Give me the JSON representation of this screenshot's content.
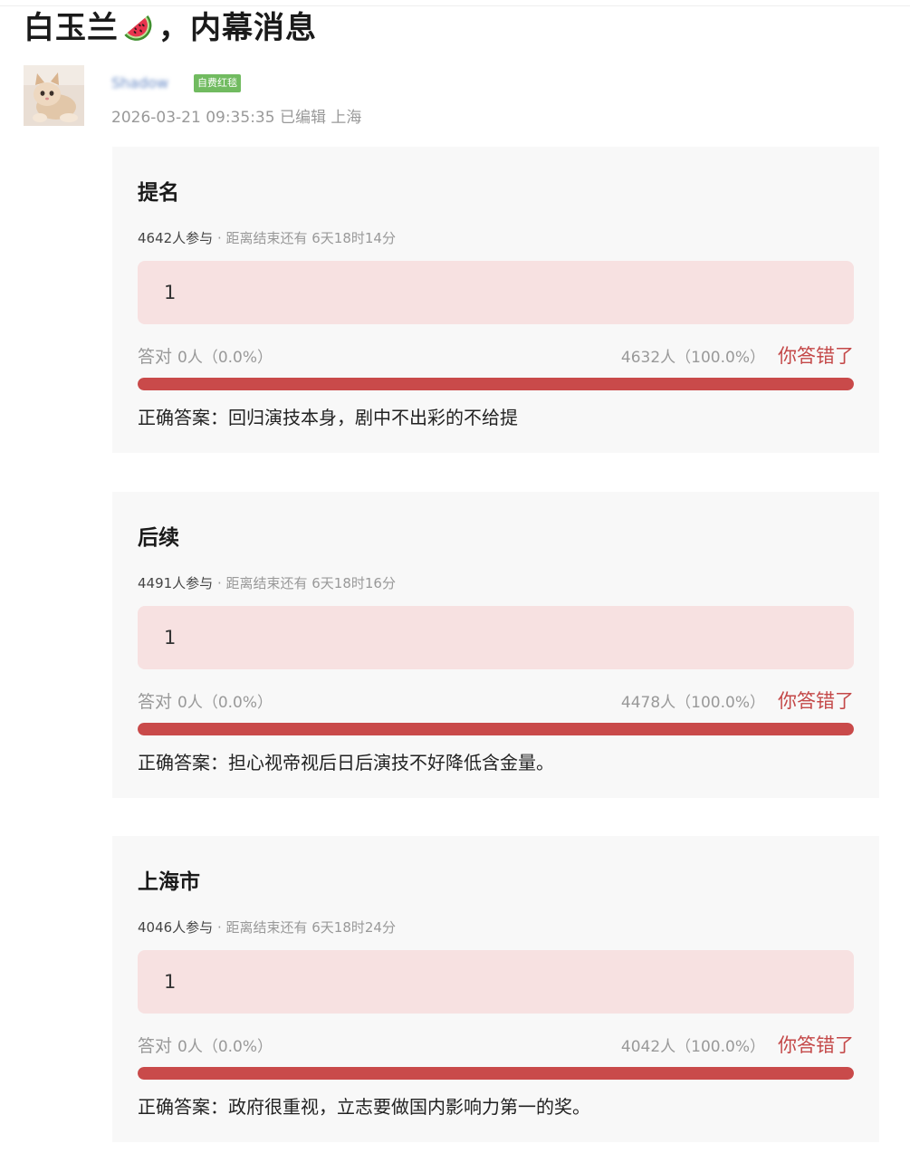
{
  "post": {
    "title_before": "白玉兰",
    "title_emoji": "watermelon-icon",
    "title_after": "，内幕消息",
    "username": "Shadow",
    "badge": "自费红毯",
    "meta": "2026-03-21 09:35:35 已编辑 上海",
    "avatar_icon": "kitten-avatar"
  },
  "colors": {
    "accent_red": "#c94a4a",
    "wrong_text": "#c44848",
    "option_bg": "#f7e1e1",
    "badge_green": "#71bb60",
    "card_bg": "#f8f8f8"
  },
  "polls": [
    {
      "title": "提名",
      "participants": "4642人参与",
      "deadline": " · 距离结束还有 6天18时14分",
      "option": "1",
      "correct_label": "答对",
      "correct_count": "0人（0.0%）",
      "wrong_count": "4632人（100.0%）",
      "wrong_label": "你答错了",
      "wrong_fraction": 1.0,
      "answer": "正确答案：回归演技本身，剧中不出彩的不给提"
    },
    {
      "title": "后续",
      "participants": "4491人参与",
      "deadline": " · 距离结束还有 6天18时16分",
      "option": "1",
      "correct_label": "答对",
      "correct_count": "0人（0.0%）",
      "wrong_count": "4478人（100.0%）",
      "wrong_label": "你答错了",
      "wrong_fraction": 1.0,
      "answer": "正确答案：担心视帝视后日后演技不好降低含金量。"
    },
    {
      "title": "上海市",
      "participants": "4046人参与",
      "deadline": " · 距离结束还有 6天18时24分",
      "option": "1",
      "correct_label": "答对",
      "correct_count": "0人（0.0%）",
      "wrong_count": "4042人（100.0%）",
      "wrong_label": "你答错了",
      "wrong_fraction": 1.0,
      "answer": "正确答案：政府很重视，立志要做国内影响力第一的奖。"
    }
  ]
}
